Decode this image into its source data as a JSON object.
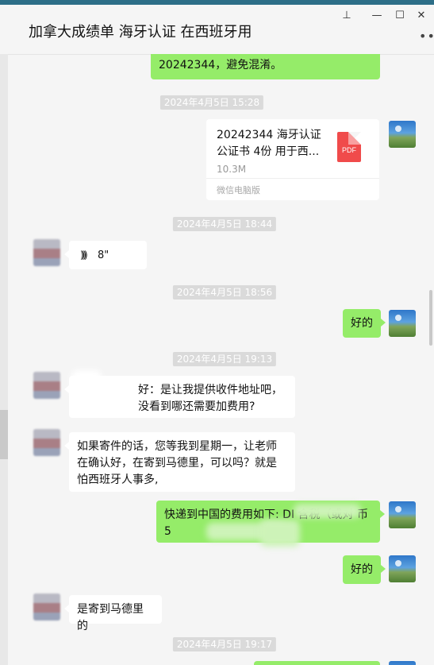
{
  "window": {
    "title": "加拿大成绩单 海牙认证 在西班牙用",
    "controls": {
      "pin": "⊥",
      "minimize": "—",
      "maximize": "☐",
      "close": "✕"
    },
    "more_icon": "•••"
  },
  "messages": {
    "m1": "20242344，避免混淆。",
    "ts1": "2024年4月5日 15:28",
    "file": {
      "name": "20242344 海牙认证 公证书 4份 用于西...",
      "size": "10.3M",
      "source": "微信电脑版",
      "icon": "PDF"
    },
    "ts2": "2024年4月5日 18:44",
    "voice": {
      "icon": "))))",
      "duration": "8\""
    },
    "ts3": "2024年4月5日 18:56",
    "reply1": "好的",
    "ts4": "2024年4月5日 19:13",
    "other1": "好：是让我提供收件地址吧，没看到哪还需要加费用?",
    "other2": "如果寄件的话，您等我到星期一，让老师在确认好，在寄到马德里，可以吗？就是怕西班牙人事多,",
    "mine_fee": "快递到中国的费用如下: DI 含税（或对 币 5",
    "reply2": "好的",
    "other3": "是寄到马德里的",
    "ts5": "2024年4月5日 19:17"
  }
}
